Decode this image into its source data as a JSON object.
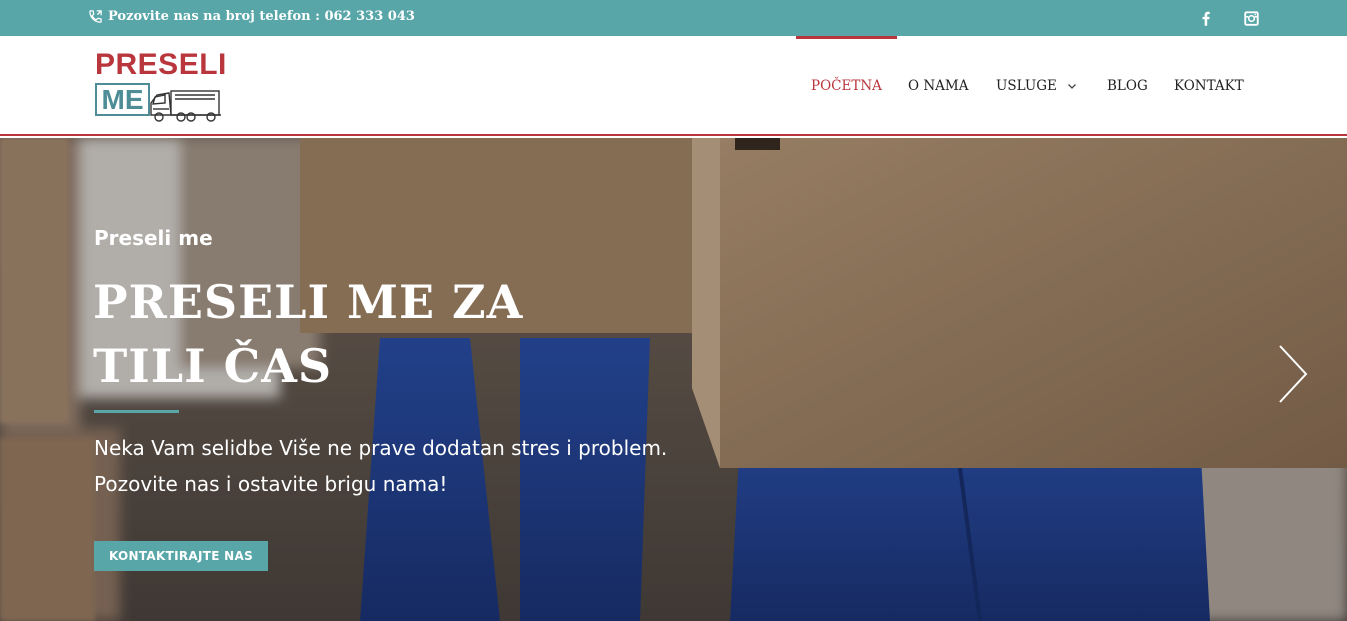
{
  "topbar": {
    "phone_text": "Pozovite nas na broj telefon : 062 333 043",
    "social": [
      {
        "name": "facebook-icon"
      },
      {
        "name": "instagram-icon"
      }
    ]
  },
  "header": {
    "logo": {
      "word1": "PRESELI",
      "word2": "ME"
    },
    "nav": [
      {
        "label": "POČETNA",
        "active": true
      },
      {
        "label": "O NAMA",
        "active": false
      },
      {
        "label": "USLUGE",
        "active": false,
        "has_dropdown": true
      },
      {
        "label": "BLOG",
        "active": false
      },
      {
        "label": "KONTAKT",
        "active": false
      }
    ]
  },
  "hero": {
    "kicker": "Preseli me",
    "title": "PRESELI ME ZA TILI ČAS",
    "description_line1": "Neka Vam selidbe Više ne prave dodatan stres i problem.",
    "description_line2": "Pozovite nas i ostavite brigu nama!",
    "cta_label": "KONTAKTIRAJTE NAS"
  },
  "colors": {
    "teal": "#58a6a8",
    "red": "#b8363c",
    "dark_text": "#222222"
  }
}
